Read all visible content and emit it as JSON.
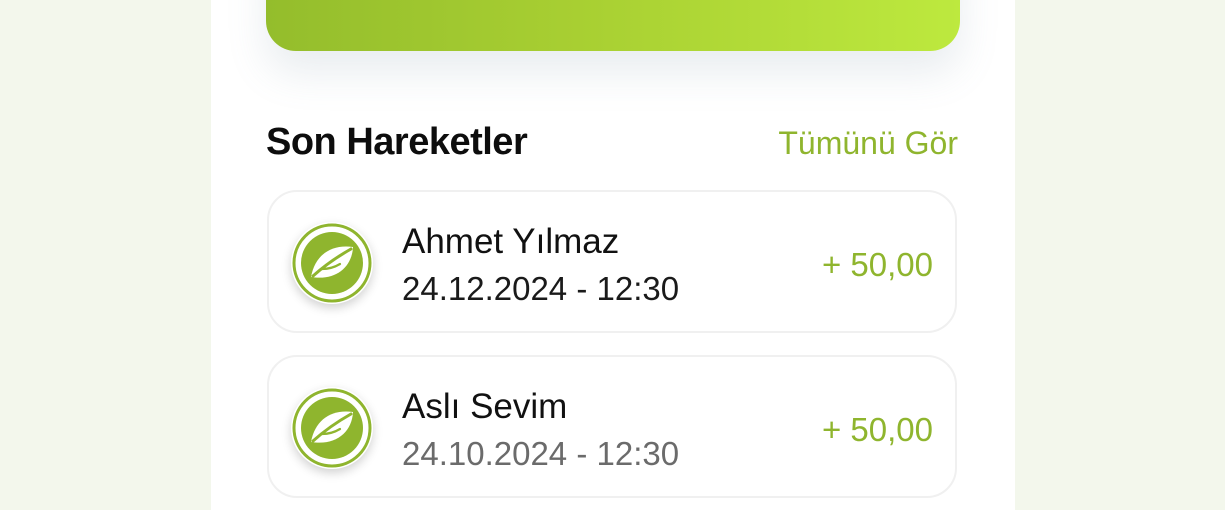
{
  "section": {
    "title": "Son Hareketler",
    "see_all": "Tümünü Gör"
  },
  "transactions": [
    {
      "name": "Ahmet Yılmaz",
      "datetime": "24.12.2024 - 12:30",
      "amount": "+ 50,00",
      "icon": "leaf-icon"
    },
    {
      "name": "Aslı Sevim",
      "datetime": "24.10.2024 - 12:30",
      "amount": "+ 50,00",
      "icon": "leaf-icon"
    }
  ],
  "colors": {
    "accent": "#8fb52e",
    "card_gradient_start": "#94bd2c",
    "card_gradient_end": "#bde93e",
    "page_background": "#f3f7ec"
  }
}
